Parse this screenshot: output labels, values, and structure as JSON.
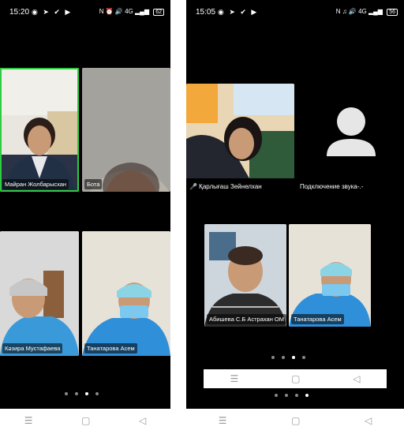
{
  "left_phone": {
    "status": {
      "time": "15:20",
      "notif_icons": "◉ ➤ ✔ ▶",
      "sys_text": "N ⏰ 🔊 4G ▂▄▆",
      "battery": "62"
    },
    "tiles": [
      {
        "label": "Майран Жолбарысхан",
        "speaking": true
      },
      {
        "label": "Бота"
      },
      {
        "label": "Кәзира Мустафаева"
      },
      {
        "label": "Танатарова Асем"
      }
    ],
    "page_dots": 4,
    "active_dot": 2,
    "nav": {
      "menu": "☰",
      "home": "▢",
      "back": "◁"
    }
  },
  "right_phone": {
    "status": {
      "time": "15:05",
      "notif_icons": "◉ ➤ ✔ ▶",
      "sys_text": "N ♫ 🔊 4G ▂▄▆",
      "battery": "56"
    },
    "tiles": [
      {
        "label": "🎤 Қарлығаш Зейнелхан"
      },
      {
        "label": "Подключение звука-.-"
      },
      {
        "label": "Абишева С.Б Астрахан ОМ"
      },
      {
        "label": "Танатарова Асем"
      }
    ],
    "page_dots": 4,
    "active_dot": 2,
    "inner_nav": {
      "menu": "☰",
      "home": "▢",
      "back": "◁"
    },
    "nav": {
      "menu": "☰",
      "home": "▢",
      "back": "◁"
    }
  }
}
